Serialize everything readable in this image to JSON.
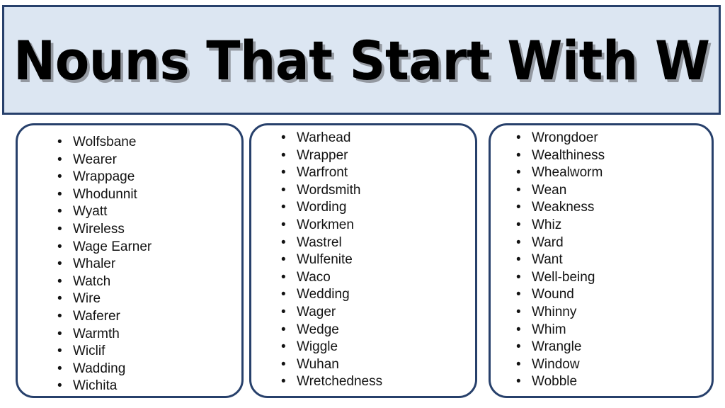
{
  "header": {
    "title": "Nouns That Start With W",
    "background_color": "#dce6f2",
    "border_color": "#27406b",
    "text_color": "#000000"
  },
  "theme": {
    "page_background": "#ffffff",
    "box_border_color": "#27406b",
    "list_text_color": "#131313",
    "bullet_glyph": "•"
  },
  "columns": [
    {
      "id": "column-1",
      "items": [
        "Wolfsbane",
        "Wearer",
        "Wrappage",
        "Whodunnit",
        "Wyatt",
        "Wireless",
        "Wage Earner",
        "Whaler",
        "Watch",
        "Wire",
        "Waferer",
        "Warmth",
        "Wiclif",
        "Wadding",
        "Wichita"
      ]
    },
    {
      "id": "column-2",
      "items": [
        "Warhead",
        "Wrapper",
        "Warfront",
        "Wordsmith",
        "Wording",
        "Workmen",
        "Wastrel",
        "Wulfenite",
        "Waco",
        "Wedding",
        "Wager",
        "Wedge",
        "Wiggle",
        "Wuhan",
        "Wretchedness"
      ]
    },
    {
      "id": "column-3",
      "items": [
        "Wrongdoer",
        "Wealthiness",
        "Whealworm",
        "Wean",
        "Weakness",
        "Whiz",
        "Ward",
        "Want",
        "Well-being",
        "Wound",
        "Whinny",
        "Whim",
        "Wrangle",
        "Window",
        "Wobble"
      ]
    }
  ]
}
